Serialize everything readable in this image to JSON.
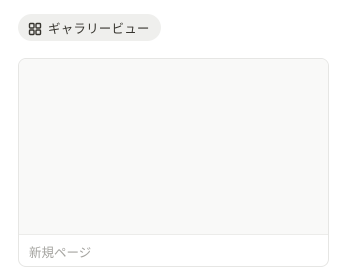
{
  "view_tab": {
    "label": "ギャラリービュー",
    "icon": "gallery-grid-icon"
  },
  "gallery": {
    "cards": [
      {
        "title": "新規ページ"
      }
    ]
  },
  "colors": {
    "tab_bg": "#efefed",
    "text": "#37352f",
    "placeholder_text": "#a5a4a0",
    "card_border": "#e6e6e4",
    "cover_bg": "#f9f9f8"
  }
}
